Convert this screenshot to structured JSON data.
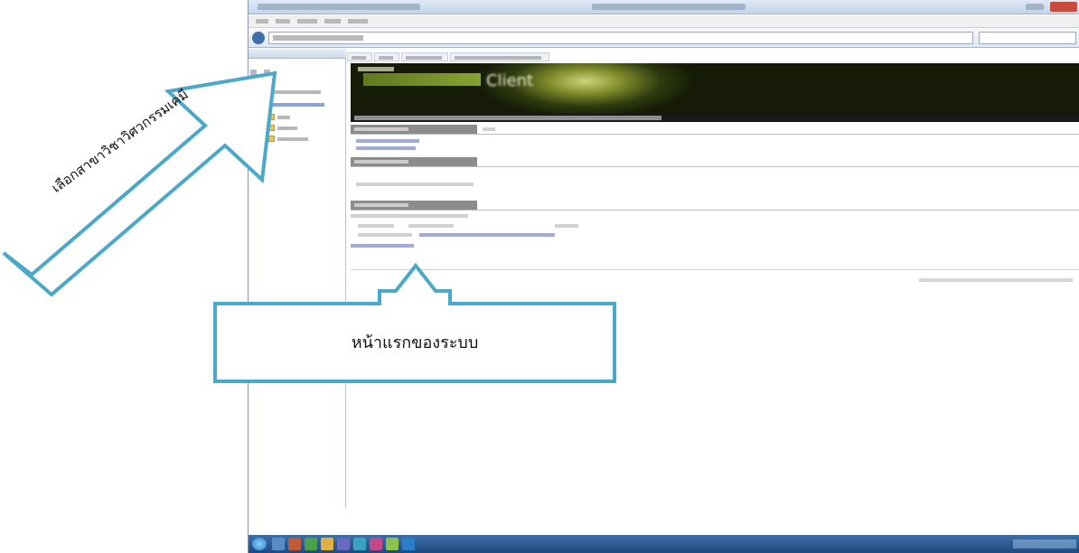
{
  "banner": {
    "client_word": "Client"
  },
  "annotations": {
    "arrow_label": "เลือกสาขาวิชาวิศวกรรมเคมี",
    "box_label": "หน้าแรกของระบบ",
    "color": "#4aa8c8"
  },
  "colors": {
    "banner_dark": "#151b06",
    "banner_accent": "#9cba3a",
    "section_header": "#8c8c8c",
    "taskbar": "#1e4a80"
  }
}
